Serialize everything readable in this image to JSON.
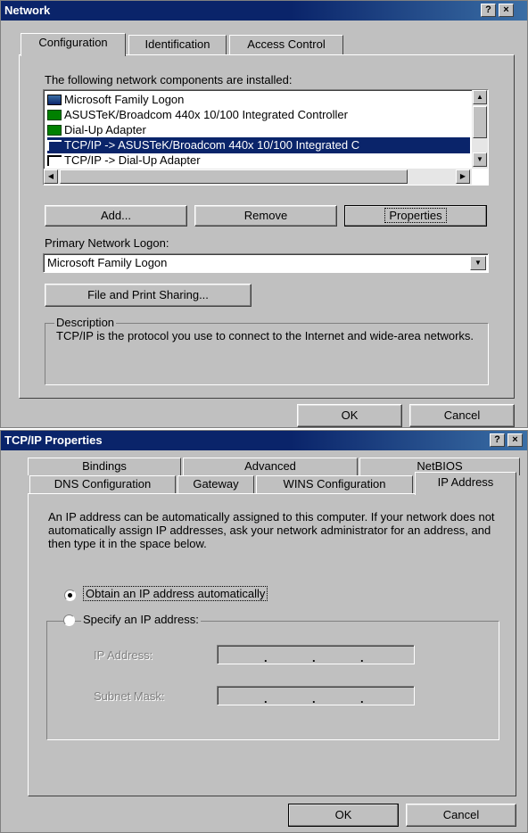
{
  "network": {
    "title": "Network",
    "title_buttons": [
      "?",
      "×"
    ],
    "tabs": [
      "Configuration",
      "Identification",
      "Access Control"
    ],
    "components_label": "The following network components are installed:",
    "components": [
      {
        "text": "Microsoft Family Logon",
        "icon": "client-icon",
        "selected": false
      },
      {
        "text": "ASUSTeK/Broadcom 440x 10/100 Integrated Controller",
        "icon": "network-adapter-icon",
        "selected": false
      },
      {
        "text": "Dial-Up Adapter",
        "icon": "network-adapter-icon",
        "selected": false
      },
      {
        "text": "TCP/IP -> ASUSTeK/Broadcom 440x 10/100 Integrated C",
        "icon": "protocol-icon",
        "selected": true
      },
      {
        "text": "TCP/IP -> Dial-Up Adapter",
        "icon": "protocol-icon",
        "selected": false
      }
    ],
    "add_label": "Add...",
    "remove_label": "Remove",
    "properties_label": "Properties",
    "primary_logon_label": "Primary Network Logon:",
    "primary_logon_value": "Microsoft Family Logon",
    "file_print_label": "File and Print Sharing...",
    "description_legend": "Description",
    "description_text": "TCP/IP is the protocol you use to connect to the Internet and wide-area networks.",
    "ok_label": "OK",
    "cancel_label": "Cancel"
  },
  "tcpip": {
    "title": "TCP/IP Properties",
    "title_buttons": [
      "?",
      "×"
    ],
    "tabs_back": [
      "Bindings",
      "Advanced",
      "NetBIOS"
    ],
    "tabs_front": [
      "DNS Configuration",
      "Gateway",
      "WINS Configuration",
      "IP Address"
    ],
    "active_tab": "IP Address",
    "intro_text": "An IP address can be automatically assigned to this computer. If your network does not automatically assign IP addresses, ask your network administrator for an address, and then type it in the space below.",
    "obtain_label": "Obtain an IP address automatically",
    "specify_label": "Specify an IP address:",
    "ip_address_label": "IP Address:",
    "subnet_mask_label": "Subnet Mask:",
    "ok_label": "OK",
    "cancel_label": "Cancel"
  }
}
